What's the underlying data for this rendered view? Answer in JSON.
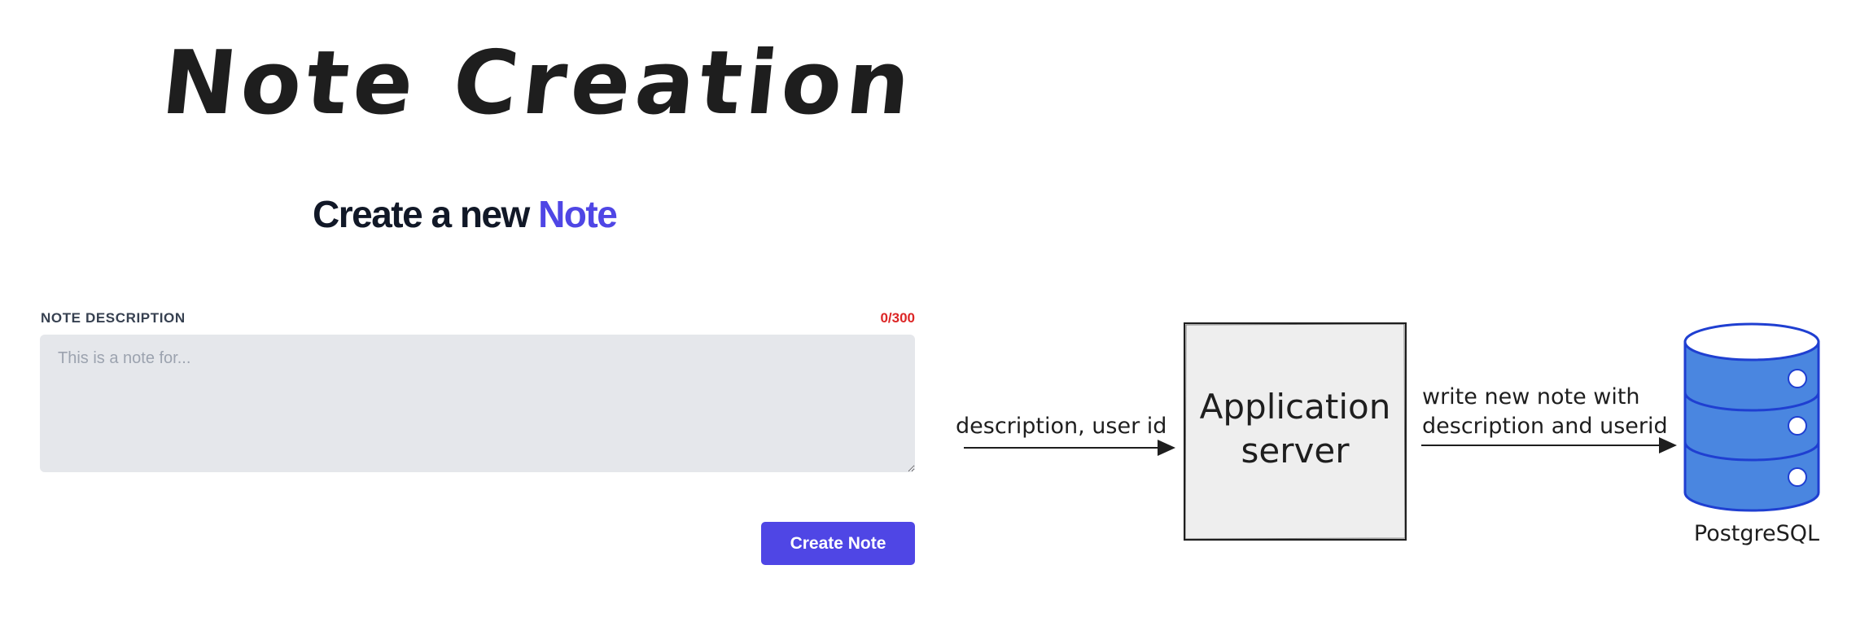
{
  "sketch": {
    "title": "Note Creation"
  },
  "form": {
    "heading_prefix": "Create a new",
    "heading_accent": "Note",
    "field_label": "NOTE DESCRIPTION",
    "char_count": "0/300",
    "description_value": "",
    "description_placeholder": "This is a note for...",
    "submit_label": "Create Note"
  },
  "diagram": {
    "input_arrow_label": "description, user id",
    "server_label_line1": "Application",
    "server_label_line2": "server",
    "output_arrow_label_line1": "write new note with",
    "output_arrow_label_line2": "description and userid",
    "database_label": "PostgreSQL"
  },
  "colors": {
    "accent": "#4f46e5",
    "counter": "#dc2626",
    "database_fill": "#4a86e0",
    "database_stroke": "#1f3fd1",
    "server_fill": "#eeeeee"
  }
}
